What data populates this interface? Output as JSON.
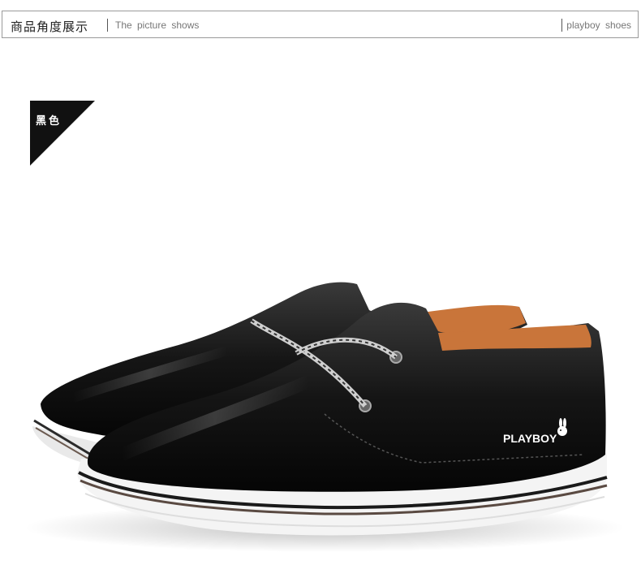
{
  "header": {
    "title": "商品角度展示",
    "subtitle": "The picture shows",
    "right_text": "playboy shoes"
  },
  "color_tag": {
    "label": "黑色",
    "bg_color": "#111111"
  },
  "product": {
    "brand_label": "PLAYBOY",
    "icon": "bunny-logo-icon"
  },
  "colors": {
    "leather": "#141414",
    "lining": "#c9753a",
    "sole": "#f4f4f4",
    "stripe": "#5a4a42"
  }
}
